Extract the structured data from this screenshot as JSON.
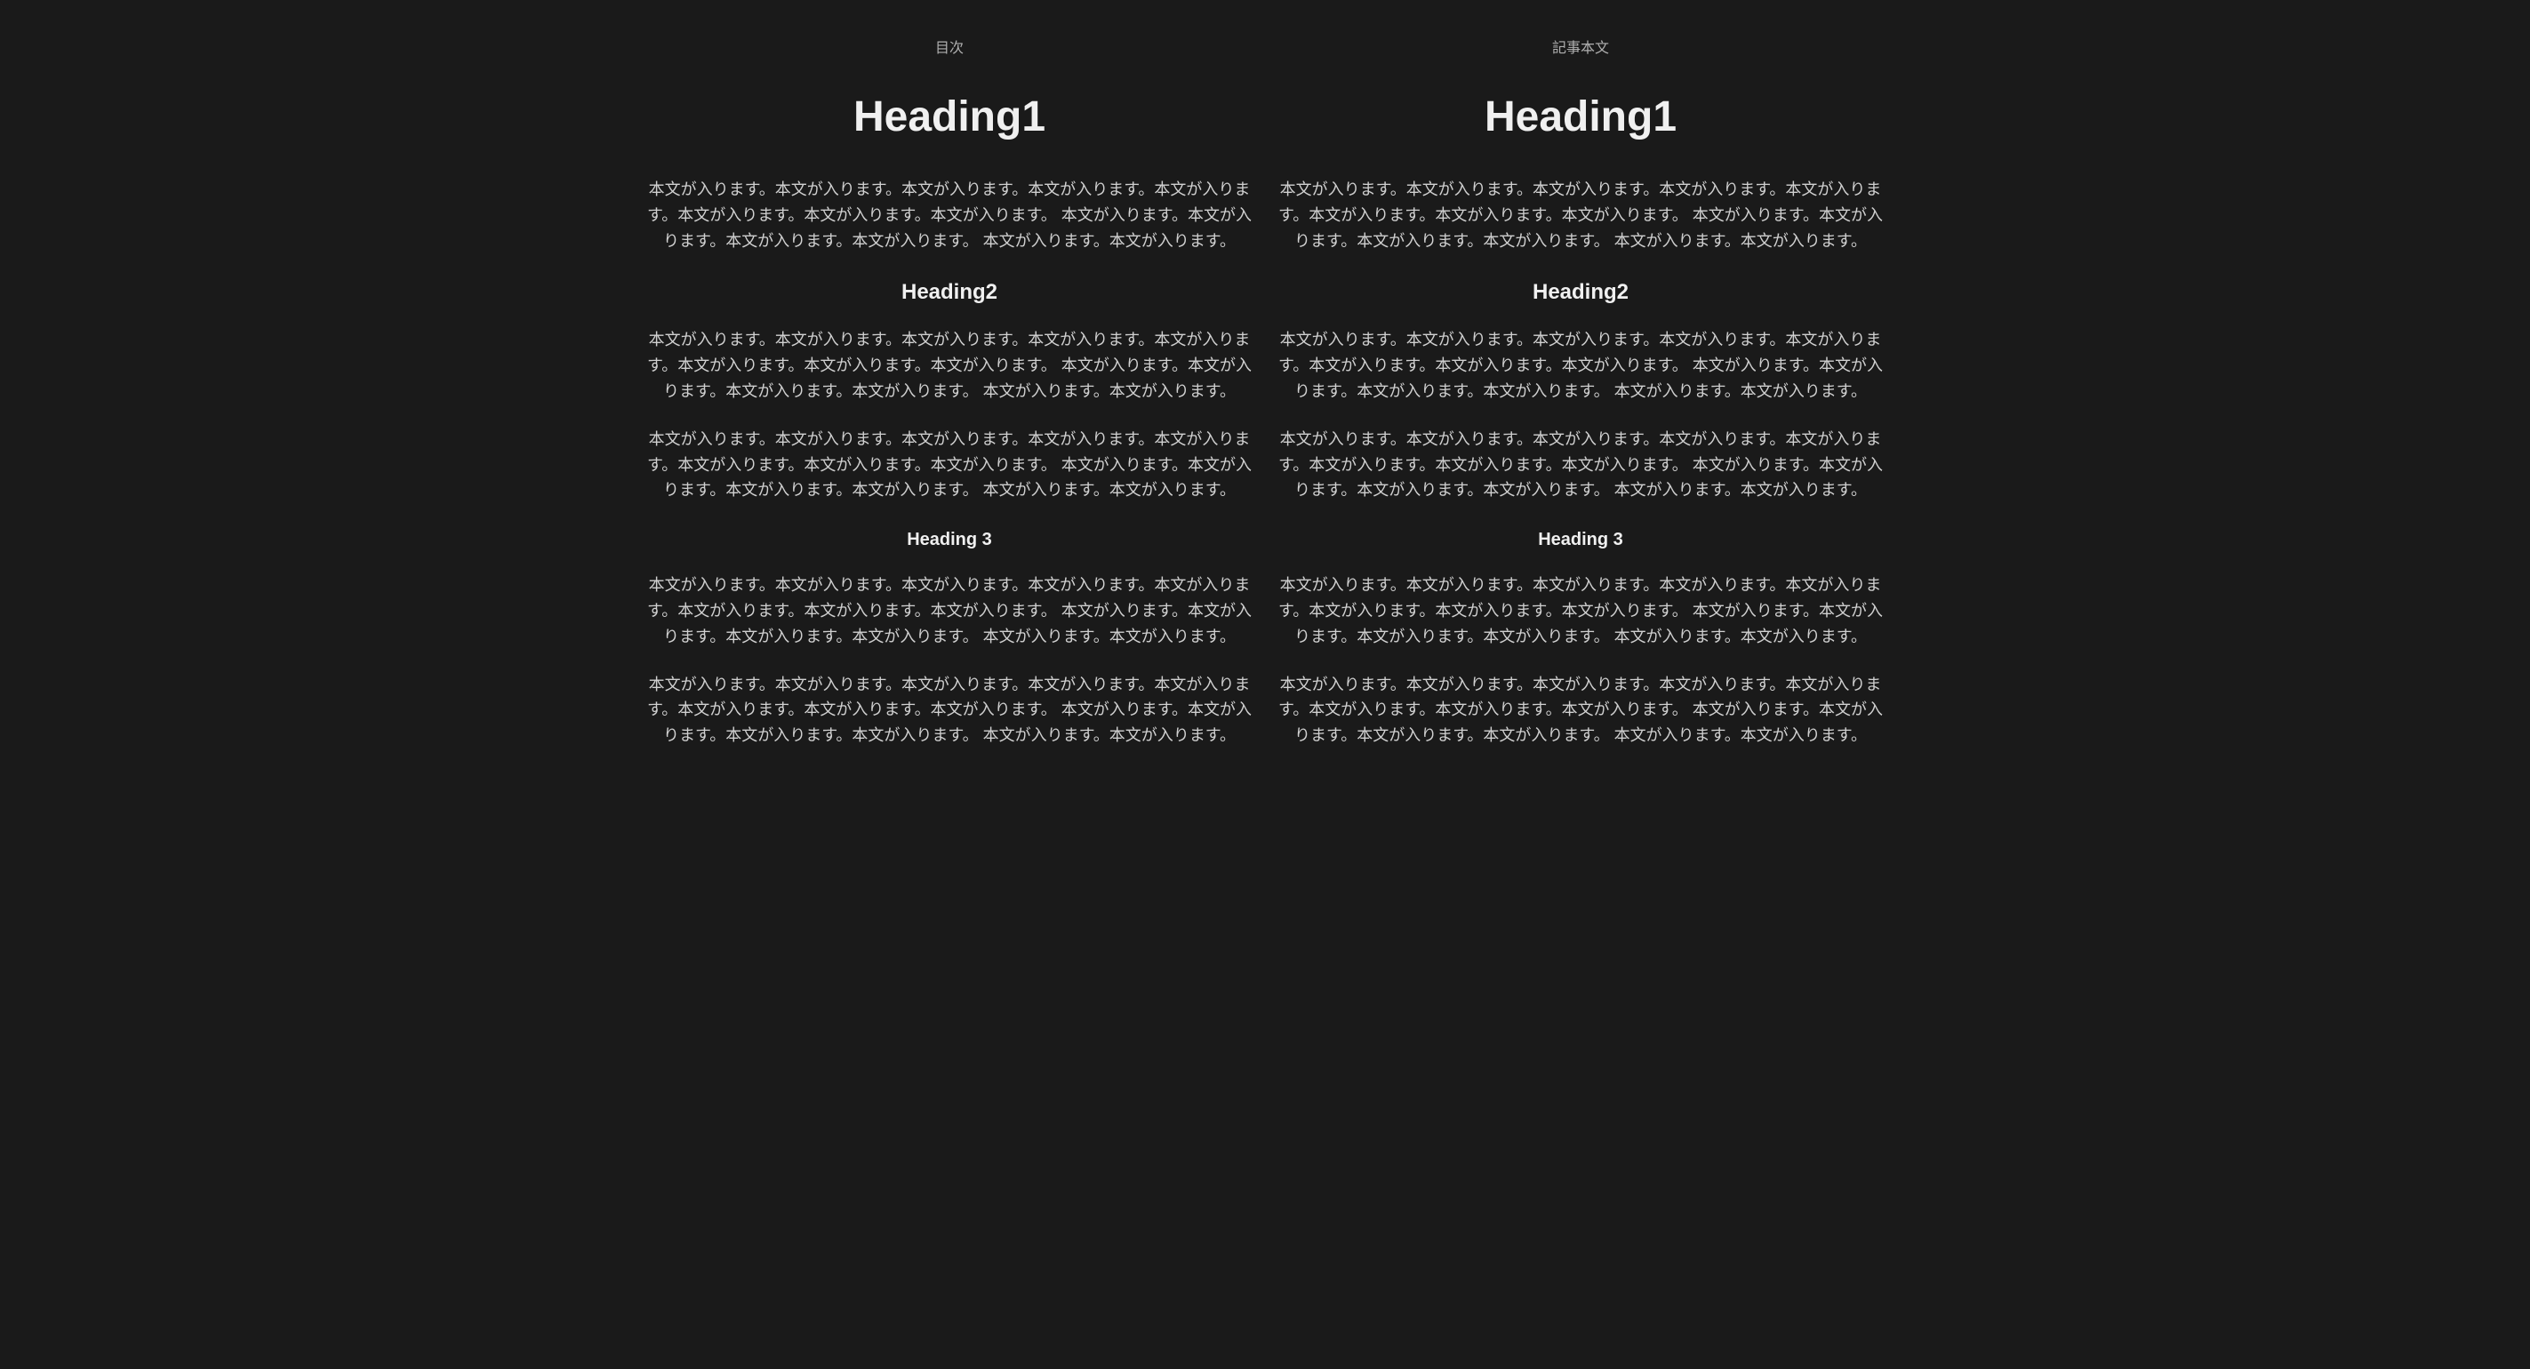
{
  "left": {
    "label": "目次",
    "heading1": "Heading1",
    "para1": "本文が入ります。本文が入ります。本文が入ります。本文が入ります。本文が入ります。本文が入ります。本文が入ります。本文が入ります。 本文が入ります。本文が入ります。本文が入ります。本文が入ります。 本文が入ります。本文が入ります。",
    "heading2": "Heading2",
    "para2": "本文が入ります。本文が入ります。本文が入ります。本文が入ります。本文が入ります。本文が入ります。本文が入ります。本文が入ります。 本文が入ります。本文が入ります。本文が入ります。本文が入ります。 本文が入ります。本文が入ります。",
    "para3": "本文が入ります。本文が入ります。本文が入ります。本文が入ります。本文が入ります。本文が入ります。本文が入ります。本文が入ります。 本文が入ります。本文が入ります。本文が入ります。本文が入ります。 本文が入ります。本文が入ります。",
    "heading3": "Heading 3",
    "para4": "本文が入ります。本文が入ります。本文が入ります。本文が入ります。本文が入ります。本文が入ります。本文が入ります。本文が入ります。 本文が入ります。本文が入ります。本文が入ります。本文が入ります。 本文が入ります。本文が入ります。",
    "para5": "本文が入ります。本文が入ります。本文が入ります。本文が入ります。本文が入ります。本文が入ります。本文が入ります。本文が入ります。 本文が入ります。本文が入ります。本文が入ります。本文が入ります。 本文が入ります。本文が入ります。"
  },
  "right": {
    "label": "記事本文",
    "heading1": "Heading1",
    "para1": "本文が入ります。本文が入ります。本文が入ります。本文が入ります。本文が入ります。本文が入ります。本文が入ります。本文が入ります。 本文が入ります。本文が入ります。本文が入ります。本文が入ります。 本文が入ります。本文が入ります。",
    "heading2": "Heading2",
    "para2": "本文が入ります。本文が入ります。本文が入ります。本文が入ります。本文が入ります。本文が入ります。本文が入ります。本文が入ります。 本文が入ります。本文が入ります。本文が入ります。本文が入ります。 本文が入ります。本文が入ります。",
    "para3": "本文が入ります。本文が入ります。本文が入ります。本文が入ります。本文が入ります。本文が入ります。本文が入ります。本文が入ります。 本文が入ります。本文が入ります。本文が入ります。本文が入ります。 本文が入ります。本文が入ります。",
    "heading3": "Heading 3",
    "para4": "本文が入ります。本文が入ります。本文が入ります。本文が入ります。本文が入ります。本文が入ります。本文が入ります。本文が入ります。 本文が入ります。本文が入ります。本文が入ります。本文が入ります。 本文が入ります。本文が入ります。",
    "para5": "本文が入ります。本文が入ります。本文が入ります。本文が入ります。本文が入ります。本文が入ります。本文が入ります。本文が入ります。 本文が入ります。本文が入ります。本文が入ります。本文が入ります。 本文が入ります。本文が入ります。"
  }
}
